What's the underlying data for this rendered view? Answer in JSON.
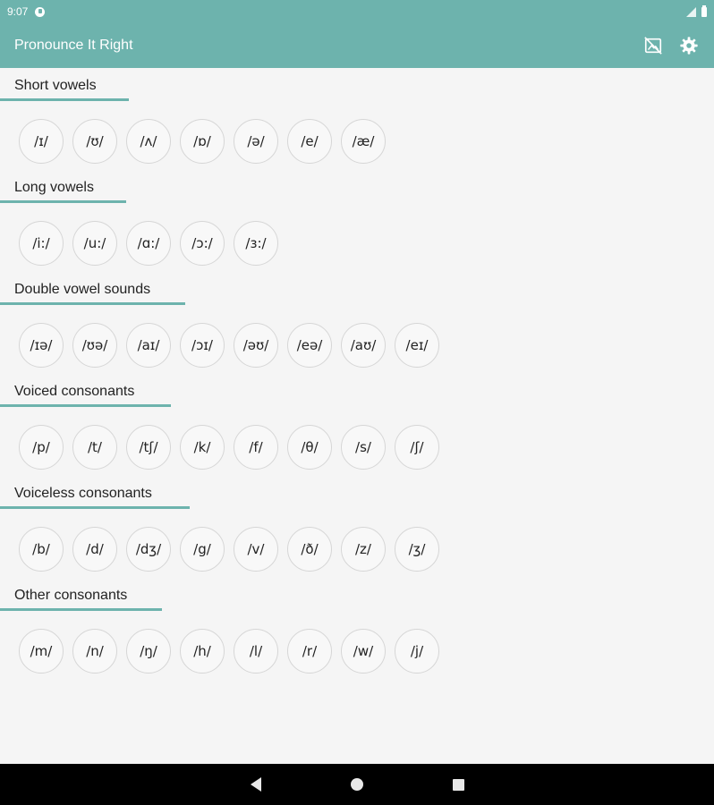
{
  "status_bar": {
    "time": "9:07",
    "icons": [
      "app-notification-icon",
      "signal-icon",
      "battery-icon"
    ]
  },
  "app_bar": {
    "title": "Pronounce It Right",
    "actions": [
      "image-off-icon",
      "gear-icon"
    ]
  },
  "colors": {
    "accent": "#6db3ad",
    "background": "#f5f5f5",
    "chip_border": "#d6d6d6"
  },
  "sections": [
    {
      "title": "Short vowels",
      "symbols": [
        "/ɪ/",
        "/ʊ/",
        "/ʌ/",
        "/ɒ/",
        "/ə/",
        "/e/",
        "/æ/"
      ]
    },
    {
      "title": "Long vowels",
      "symbols": [
        "/i:/",
        "/u:/",
        "/ɑ:/",
        "/ɔ:/",
        "/ɜ:/"
      ]
    },
    {
      "title": "Double vowel sounds",
      "symbols": [
        "/ɪə/",
        "/ʊə/",
        "/aɪ/",
        "/ɔɪ/",
        "/əʊ/",
        "/eə/",
        "/aʊ/",
        "/eɪ/"
      ]
    },
    {
      "title": "Voiced consonants",
      "symbols": [
        "/p/",
        "/t/",
        "/tʃ/",
        "/k/",
        "/f/",
        "/θ/",
        "/s/",
        "/ʃ/"
      ]
    },
    {
      "title": "Voiceless consonants",
      "symbols": [
        "/b/",
        "/d/",
        "/dʒ/",
        "/g/",
        "/v/",
        "/ð/",
        "/z/",
        "/ʒ/"
      ]
    },
    {
      "title": "Other consonants",
      "symbols": [
        "/m/",
        "/n/",
        "/ŋ/",
        "/h/",
        "/l/",
        "/r/",
        "/w/",
        "/j/"
      ]
    }
  ],
  "nav_bar": {
    "buttons": [
      "back-icon",
      "home-icon",
      "recents-icon"
    ]
  }
}
